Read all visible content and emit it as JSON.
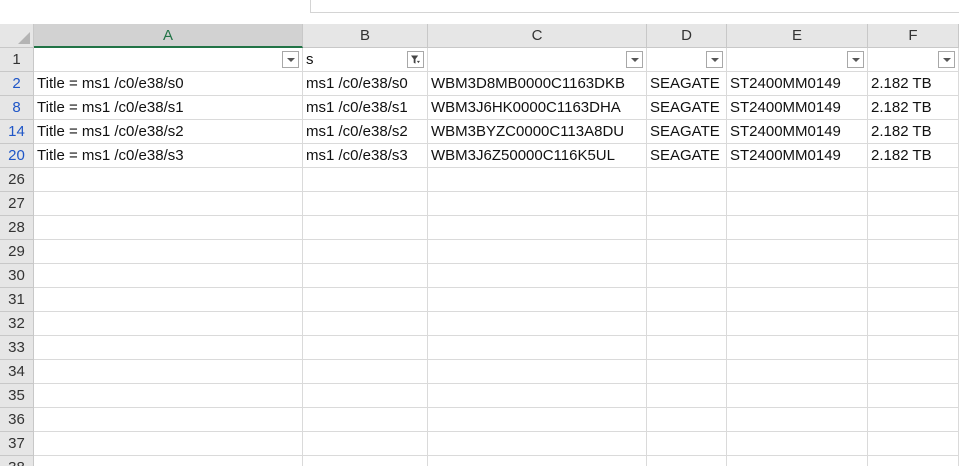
{
  "columns": [
    "A",
    "B",
    "C",
    "D",
    "E",
    "F"
  ],
  "header_row": {
    "row_number": "1",
    "cells": [
      "",
      "s",
      "",
      "",
      "",
      ""
    ],
    "filter_active_column": "B"
  },
  "rows": [
    {
      "row_number": "2",
      "cells": [
        "Title = ms1 /c0/e38/s0",
        "ms1 /c0/e38/s0",
        "WBM3D8MB0000C1163DKB",
        "SEAGATE",
        "ST2400MM0149",
        "2.182 TB"
      ]
    },
    {
      "row_number": "8",
      "cells": [
        "Title = ms1 /c0/e38/s1",
        "ms1 /c0/e38/s1",
        "WBM3J6HK0000C1163DHA",
        "SEAGATE",
        "ST2400MM0149",
        "2.182 TB"
      ]
    },
    {
      "row_number": "14",
      "cells": [
        "Title = ms1 /c0/e38/s2",
        "ms1 /c0/e38/s2",
        "WBM3BYZC0000C113A8DU",
        "SEAGATE",
        "ST2400MM0149",
        "2.182 TB"
      ]
    },
    {
      "row_number": "20",
      "cells": [
        "Title = ms1 /c0/e38/s3",
        "ms1 /c0/e38/s3",
        "WBM3J6Z50000C116K5UL",
        "SEAGATE",
        "ST2400MM0149",
        "2.182 TB"
      ]
    }
  ],
  "empty_rows": [
    "26",
    "27",
    "28",
    "29",
    "30",
    "31",
    "32",
    "33",
    "34",
    "35",
    "36",
    "37",
    "38"
  ],
  "colors": {
    "selected_column_header": "#217346",
    "filtered_row_number": "#1f56c7",
    "gridline": "#dadada"
  }
}
